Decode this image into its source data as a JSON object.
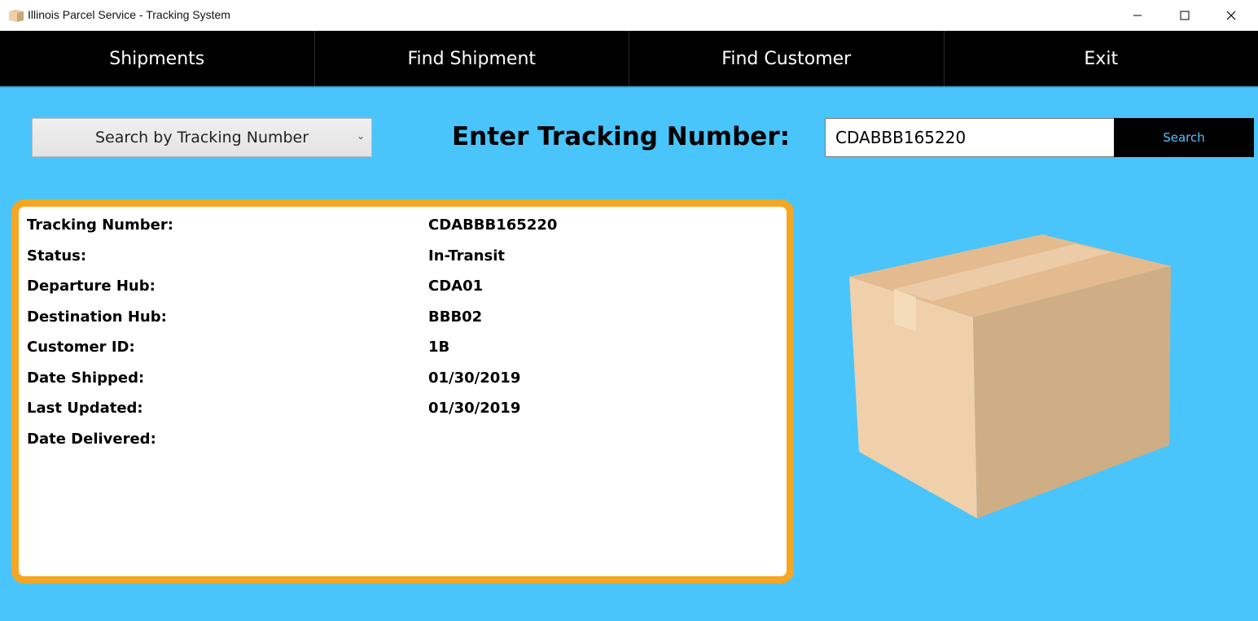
{
  "window": {
    "title": "Illinois Parcel Service - Tracking System"
  },
  "nav": {
    "items": [
      "Shipments",
      "Find Shipment",
      "Find Customer",
      "Exit"
    ]
  },
  "search": {
    "mode_selected": "Search by Tracking Number",
    "prompt": "Enter Tracking Number:",
    "input_value": "CDABBB165220",
    "button_label": "Search"
  },
  "details": {
    "rows": [
      {
        "label": "Tracking Number:",
        "value": "CDABBB165220"
      },
      {
        "label": "Status:",
        "value": "In-Transit"
      },
      {
        "label": "Departure Hub:",
        "value": "CDA01"
      },
      {
        "label": "Destination Hub:",
        "value": "BBB02"
      },
      {
        "label": "Customer ID:",
        "value": "1B"
      },
      {
        "label": "Date Shipped:",
        "value": "01/30/2019"
      },
      {
        "label": "Last Updated:",
        "value": "01/30/2019"
      },
      {
        "label": "Date Delivered:",
        "value": ""
      }
    ]
  },
  "colors": {
    "background": "#49c5fb",
    "nav_background": "#000000",
    "card_border": "#f5a623",
    "search_button_text": "#4fc3ff"
  }
}
